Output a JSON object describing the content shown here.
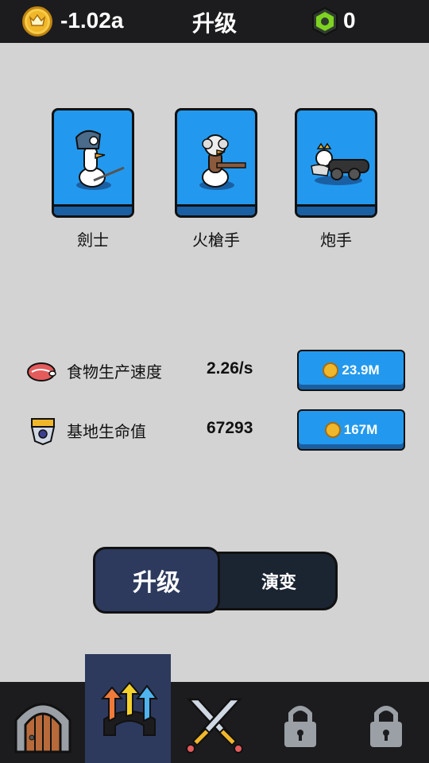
{
  "header": {
    "coins": "-1.02a",
    "title": "升级",
    "gems": "0",
    "coin_icon": "crown-coin-icon",
    "gem_icon": "green-gem-icon"
  },
  "units": [
    {
      "label": "劍士",
      "icon": "swordsman-goose-icon"
    },
    {
      "label": "火槍手",
      "icon": "musketeer-goose-icon"
    },
    {
      "label": "炮手",
      "icon": "cannoneer-goose-icon"
    }
  ],
  "stats": [
    {
      "label": "食物生产速度",
      "value": "2.26/s",
      "cost": "23.9M",
      "icon": "meat-icon"
    },
    {
      "label": "基地生命值",
      "value": "67293",
      "cost": "167M",
      "icon": "castle-shield-icon"
    }
  ],
  "toggle": {
    "upgrade_label": "升级",
    "evolve_label": "演变"
  },
  "nav": [
    {
      "name": "castle-gate-icon",
      "active": false,
      "locked": false
    },
    {
      "name": "upgrade-arrows-icon",
      "active": true,
      "locked": false
    },
    {
      "name": "crossed-swords-icon",
      "active": false,
      "locked": false
    },
    {
      "name": "lock-icon",
      "active": false,
      "locked": true
    },
    {
      "name": "lock-icon",
      "active": false,
      "locked": true
    }
  ],
  "colors": {
    "accent_blue": "#2299ee",
    "dark_navy": "#2d3a5e",
    "background": "#d3d3d3",
    "topbar": "#1c1c1e"
  }
}
